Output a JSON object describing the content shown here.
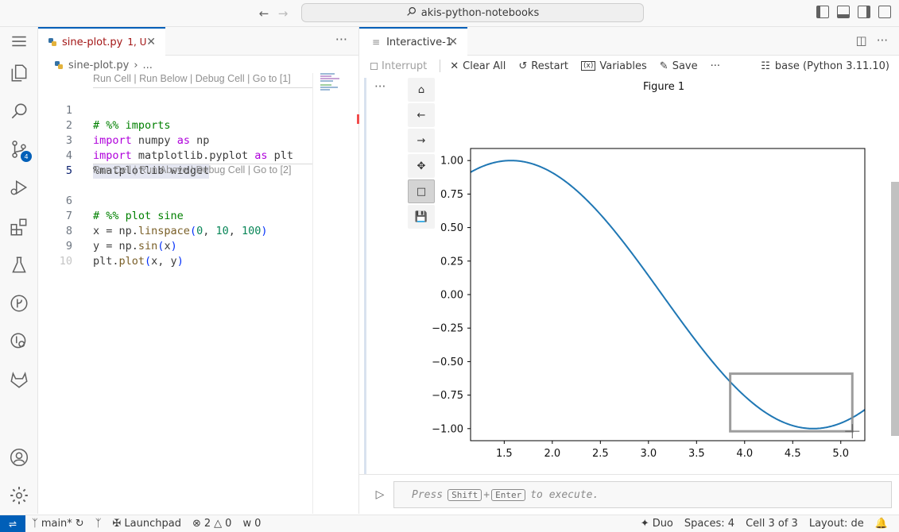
{
  "window": {
    "search_text": "akis-python-notebooks"
  },
  "activity_bar": {
    "source_control_badge": "4"
  },
  "left_editor": {
    "tab_title": "sine-plot.py",
    "tab_status": "1, U",
    "breadcrumb_file": "sine-plot.py",
    "breadcrumb_rest": "...",
    "codelens_1": "Run Cell | Run Below | Debug Cell | Go to [1]",
    "codelens_2": "Run Cell | Run Above | Debug Cell | Go to [2]",
    "line_numbers": [
      "1",
      "2",
      "3",
      "4",
      "5",
      "6",
      "7",
      "8",
      "9",
      "10"
    ],
    "lines": [
      "# %% imports",
      "import numpy as np",
      "import matplotlib.pyplot as plt",
      "%matplotlib widget",
      "",
      "# %% plot sine",
      "x = np.linspace(0, 10, 100)",
      "y = np.sin(x)",
      "plt.plot(x, y)",
      ""
    ]
  },
  "right_editor": {
    "tab_title": "Interactive-1",
    "toolbar": {
      "interrupt": "Interrupt",
      "clear_all": "Clear All",
      "restart": "Restart",
      "variables": "Variables",
      "save": "Save",
      "more": "···",
      "kernel": "base (Python 3.11.10)"
    },
    "input_placeholder_press": "Press",
    "input_key_shift": "Shift",
    "input_plus": "+",
    "input_key_enter": "Enter",
    "input_placeholder_tail": "to execute."
  },
  "chart_data": {
    "type": "line",
    "title": "Figure 1",
    "xlim": [
      1.15,
      5.25
    ],
    "ylim": [
      -1.09,
      1.09
    ],
    "xticks": [
      1.5,
      2.0,
      2.5,
      3.0,
      3.5,
      4.0,
      4.5,
      5.0
    ],
    "xtick_labels": [
      "1.5",
      "2.0",
      "2.5",
      "3.0",
      "3.5",
      "4.0",
      "4.5",
      "5.0"
    ],
    "yticks": [
      1.0,
      0.75,
      0.5,
      0.25,
      0.0,
      -0.25,
      -0.5,
      -0.75,
      -1.0
    ],
    "ytick_labels": [
      "1.00",
      "0.75",
      "0.50",
      "0.25",
      "0.00",
      "−0.25",
      "−0.50",
      "−0.75",
      "−1.00"
    ],
    "series": [
      {
        "function": "sin(x)",
        "color": "#1f77b4"
      }
    ],
    "zoom_rect": {
      "x0": 3.85,
      "x1": 5.12,
      "y0": -1.02,
      "y1": -0.59
    },
    "xlabel": "",
    "ylabel": "",
    "grid": false
  },
  "status_bar": {
    "branch": "main*",
    "launchpad": "Launchpad",
    "errors": "2",
    "warnings": "0",
    "ports": "0",
    "duo": "Duo",
    "spaces": "Spaces: 4",
    "cell": "Cell 3 of 3",
    "layout": "Layout: de"
  },
  "colors": {
    "accent": "#005fb8",
    "line": "#1f77b4",
    "modified": "#a31515"
  }
}
